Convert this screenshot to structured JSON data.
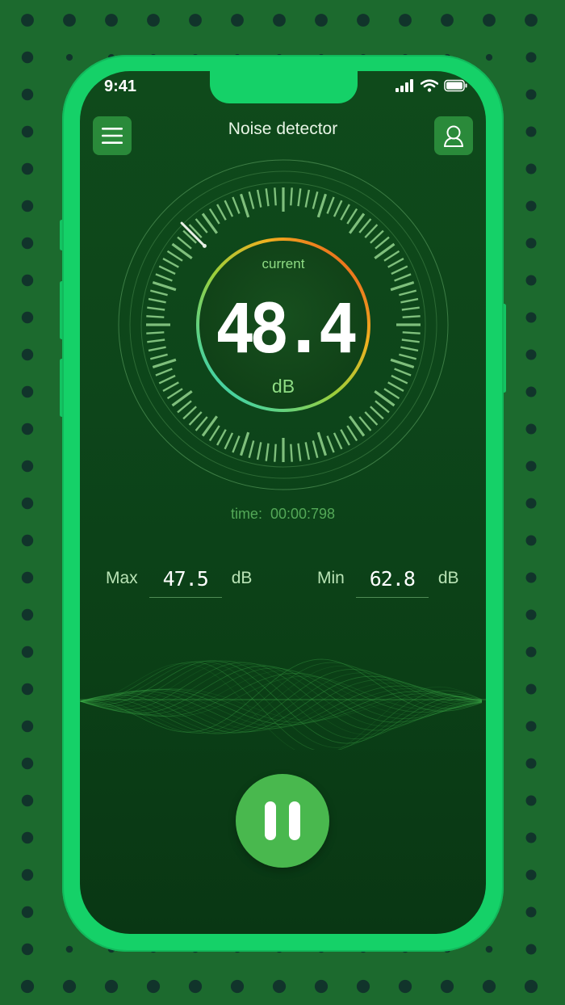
{
  "status_bar": {
    "time": "9:41"
  },
  "header": {
    "title": "Noise detector",
    "menu_icon": "menu-icon",
    "profile_icon": "profile-icon"
  },
  "gauge": {
    "label_top": "current",
    "value": "48.4",
    "unit": "dB",
    "needle_level": 0.12
  },
  "timer": {
    "label": "time:",
    "value": "00:00:798"
  },
  "stats": {
    "max": {
      "label": "Max",
      "value": "47.5",
      "unit": "dB"
    },
    "min": {
      "label": "Min",
      "value": "62.8",
      "unit": "dB"
    }
  },
  "controls": {
    "pause_icon": "pause-icon"
  },
  "colors": {
    "background": "#1c6a2e",
    "frame": "#15d168",
    "screen": "#0f4a1b",
    "tick": "#7fbf7c",
    "button": "#49b84e",
    "ring_start": "#20d4d0",
    "ring_mid": "#f0b020",
    "ring_end": "#e8431a"
  }
}
